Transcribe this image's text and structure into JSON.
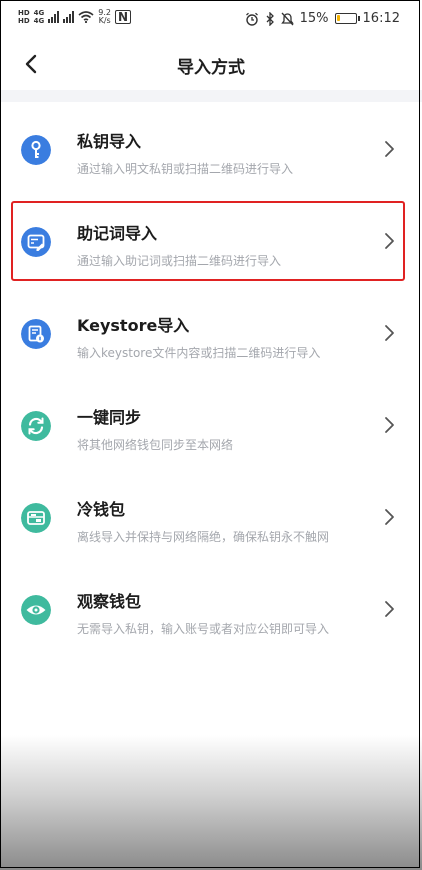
{
  "status_bar": {
    "sim1": "HD",
    "sim2": "HD",
    "network1": "4G",
    "network2": "4G",
    "speed_value": "9.2",
    "speed_unit": "K/s",
    "nfc": "N",
    "battery": "15%",
    "battery_level": 0.15,
    "time": "16:12",
    "icons": [
      "alarm-icon",
      "bluetooth-icon",
      "mute-icon",
      "battery-icon"
    ]
  },
  "header": {
    "title": "导入方式",
    "back_icon": "chevron-left-icon"
  },
  "items": [
    {
      "name": "私钥导入",
      "desc": "通过输入明文私钥或扫描二维码进行导入",
      "icon": "key-icon",
      "color": "#3a7de0"
    },
    {
      "name": "助记词导入",
      "desc": "通过输入助记词或扫描二维码进行导入",
      "icon": "mnemonic-icon",
      "color": "#3a7de0"
    },
    {
      "name": "Keystore导入",
      "desc": "输入keystore文件内容或扫描二维码进行导入",
      "icon": "keystore-icon",
      "color": "#3a7de0"
    },
    {
      "name": "一键同步",
      "desc": "将其他网络钱包同步至本网络",
      "icon": "sync-icon",
      "color": "#3fba9e"
    },
    {
      "name": "冷钱包",
      "desc": "离线导入并保持与网络隔绝，确保私钥永不触网",
      "icon": "cold-wallet-icon",
      "color": "#3fba9e"
    },
    {
      "name": "观察钱包",
      "desc": "无需导入私钥，输入账号或者对应公钥即可导入",
      "icon": "eye-icon",
      "color": "#3fba9e"
    }
  ],
  "highlight_color": "#e02222"
}
